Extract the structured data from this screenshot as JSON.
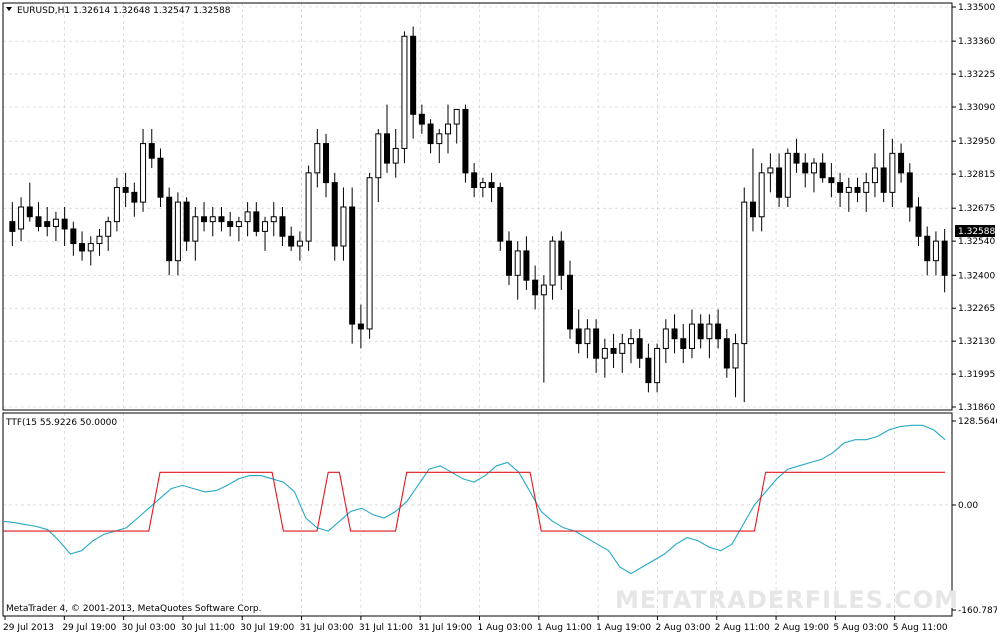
{
  "symbol_info": "EURUSD,H1  1.32614 1.32648 1.32547 1.32588",
  "indicator_info": "TTF(15 55.9226 50.0000",
  "copyright": "MetaTrader 4, © 2001-2013, MetaQuotes Software Corp.",
  "watermark": "METATRADERFILES.COM",
  "current_price": "1.32588",
  "colors": {
    "background": "#ffffff",
    "grid": "#c8c8c8",
    "bull_candle_fill": "#ffffff",
    "bear_candle_fill": "#000000",
    "ttf_line": "#26a9c7",
    "signal_line": "#e0181e",
    "price_badge": "#000000"
  },
  "chart_data": [
    {
      "type": "candlestick",
      "symbol": "EURUSD",
      "timeframe": "H1",
      "y_ticks": [
        "1.33500",
        "1.33360",
        "1.33225",
        "1.33090",
        "1.32950",
        "1.32815",
        "1.32675",
        "1.32540",
        "1.32400",
        "1.32265",
        "1.32130",
        "1.31995",
        "1.31860"
      ],
      "ylim": [
        1.3186,
        1.335
      ],
      "x_ticks": [
        "29 Jul 2013",
        "29 Jul 19:00",
        "30 Jul 03:00",
        "30 Jul 11:00",
        "30 Jul 19:00",
        "31 Jul 03:00",
        "31 Jul 11:00",
        "31 Jul 19:00",
        "1 Aug 03:00",
        "1 Aug 11:00",
        "1 Aug 19:00",
        "2 Aug 03:00",
        "2 Aug 11:00",
        "2 Aug 19:00",
        "5 Aug 03:00",
        "5 Aug 11:00"
      ],
      "ohlc": [
        [
          1.3262,
          1.327,
          1.3252,
          1.3258
        ],
        [
          1.3259,
          1.3272,
          1.3254,
          1.3268
        ],
        [
          1.3268,
          1.3278,
          1.3262,
          1.3264
        ],
        [
          1.3264,
          1.327,
          1.3258,
          1.326
        ],
        [
          1.3262,
          1.3268,
          1.3256,
          1.326
        ],
        [
          1.326,
          1.3266,
          1.3254,
          1.3263
        ],
        [
          1.3263,
          1.3268,
          1.3252,
          1.3259
        ],
        [
          1.3259,
          1.3262,
          1.3248,
          1.3253
        ],
        [
          1.3253,
          1.3258,
          1.3246,
          1.325
        ],
        [
          1.325,
          1.3256,
          1.3244,
          1.3253
        ],
        [
          1.3253,
          1.3259,
          1.3248,
          1.3256
        ],
        [
          1.3256,
          1.3264,
          1.325,
          1.3262
        ],
        [
          1.3262,
          1.328,
          1.3258,
          1.3276
        ],
        [
          1.3276,
          1.3282,
          1.3268,
          1.3274
        ],
        [
          1.3274,
          1.3278,
          1.3264,
          1.327
        ],
        [
          1.327,
          1.33,
          1.3266,
          1.3294
        ],
        [
          1.3294,
          1.33,
          1.3284,
          1.3288
        ],
        [
          1.3288,
          1.3292,
          1.3268,
          1.3272
        ],
        [
          1.3272,
          1.3276,
          1.324,
          1.3246
        ],
        [
          1.3246,
          1.3274,
          1.324,
          1.327
        ],
        [
          1.327,
          1.3272,
          1.325,
          1.3254
        ],
        [
          1.3254,
          1.3268,
          1.3246,
          1.3264
        ],
        [
          1.3264,
          1.327,
          1.3258,
          1.3262
        ],
        [
          1.3262,
          1.3268,
          1.3256,
          1.3264
        ],
        [
          1.3264,
          1.3268,
          1.3258,
          1.3262
        ],
        [
          1.3262,
          1.3266,
          1.3256,
          1.326
        ],
        [
          1.326,
          1.3264,
          1.3254,
          1.3262
        ],
        [
          1.3262,
          1.327,
          1.3256,
          1.3266
        ],
        [
          1.3266,
          1.327,
          1.3256,
          1.3258
        ],
        [
          1.3258,
          1.3264,
          1.325,
          1.3262
        ],
        [
          1.3262,
          1.327,
          1.3256,
          1.3264
        ],
        [
          1.3264,
          1.3268,
          1.3252,
          1.3256
        ],
        [
          1.3256,
          1.326,
          1.325,
          1.3252
        ],
        [
          1.3252,
          1.3258,
          1.3246,
          1.3254
        ],
        [
          1.3254,
          1.3285,
          1.325,
          1.3282
        ],
        [
          1.3282,
          1.33,
          1.3276,
          1.3294
        ],
        [
          1.3294,
          1.3298,
          1.3272,
          1.3278
        ],
        [
          1.3278,
          1.3282,
          1.3246,
          1.3252
        ],
        [
          1.3252,
          1.3276,
          1.3246,
          1.3268
        ],
        [
          1.3268,
          1.3276,
          1.3212,
          1.322
        ],
        [
          1.322,
          1.3228,
          1.321,
          1.3218
        ],
        [
          1.3218,
          1.3282,
          1.3214,
          1.328
        ],
        [
          1.328,
          1.33,
          1.327,
          1.3298
        ],
        [
          1.3298,
          1.331,
          1.3282,
          1.3286
        ],
        [
          1.3286,
          1.33,
          1.328,
          1.3292
        ],
        [
          1.3292,
          1.334,
          1.3286,
          1.3338
        ],
        [
          1.3338,
          1.3342,
          1.3296,
          1.3306
        ],
        [
          1.3306,
          1.331,
          1.3298,
          1.3302
        ],
        [
          1.3302,
          1.3304,
          1.329,
          1.3294
        ],
        [
          1.3294,
          1.33,
          1.3286,
          1.3298
        ],
        [
          1.3298,
          1.331,
          1.329,
          1.3302
        ],
        [
          1.3302,
          1.3306,
          1.3294,
          1.3308
        ],
        [
          1.3308,
          1.331,
          1.3278,
          1.3282
        ],
        [
          1.3282,
          1.3286,
          1.3272,
          1.3276
        ],
        [
          1.3276,
          1.328,
          1.3272,
          1.3278
        ],
        [
          1.3278,
          1.3282,
          1.327,
          1.3276
        ],
        [
          1.3276,
          1.3278,
          1.325,
          1.3254
        ],
        [
          1.3254,
          1.3258,
          1.3236,
          1.324
        ],
        [
          1.324,
          1.3254,
          1.323,
          1.325
        ],
        [
          1.325,
          1.3256,
          1.3234,
          1.3238
        ],
        [
          1.3238,
          1.3244,
          1.3226,
          1.3232
        ],
        [
          1.3232,
          1.324,
          1.3196,
          1.3236
        ],
        [
          1.3236,
          1.3256,
          1.323,
          1.3254
        ],
        [
          1.3254,
          1.3258,
          1.3234,
          1.324
        ],
        [
          1.324,
          1.3246,
          1.3214,
          1.3218
        ],
        [
          1.3218,
          1.3226,
          1.3208,
          1.3212
        ],
        [
          1.3212,
          1.3222,
          1.3206,
          1.3218
        ],
        [
          1.3218,
          1.3222,
          1.32,
          1.3206
        ],
        [
          1.3206,
          1.3214,
          1.3198,
          1.321
        ],
        [
          1.321,
          1.3216,
          1.3202,
          1.3208
        ],
        [
          1.3208,
          1.3216,
          1.32,
          1.3212
        ],
        [
          1.3212,
          1.3218,
          1.3204,
          1.3214
        ],
        [
          1.3214,
          1.3218,
          1.3202,
          1.3206
        ],
        [
          1.3206,
          1.3212,
          1.3192,
          1.3196
        ],
        [
          1.3196,
          1.3212,
          1.3192,
          1.321
        ],
        [
          1.321,
          1.3222,
          1.3204,
          1.3218
        ],
        [
          1.3218,
          1.3224,
          1.3208,
          1.3214
        ],
        [
          1.3214,
          1.322,
          1.3204,
          1.321
        ],
        [
          1.321,
          1.3226,
          1.3206,
          1.322
        ],
        [
          1.322,
          1.3224,
          1.321,
          1.3214
        ],
        [
          1.3214,
          1.3224,
          1.3206,
          1.322
        ],
        [
          1.322,
          1.3226,
          1.321,
          1.3214
        ],
        [
          1.3214,
          1.3218,
          1.3198,
          1.3202
        ],
        [
          1.3202,
          1.3216,
          1.319,
          1.3212
        ],
        [
          1.3212,
          1.3276,
          1.3188,
          1.327
        ],
        [
          1.327,
          1.3292,
          1.3258,
          1.3264
        ],
        [
          1.3264,
          1.3286,
          1.3258,
          1.3282
        ],
        [
          1.3282,
          1.329,
          1.3274,
          1.3284
        ],
        [
          1.3284,
          1.329,
          1.3268,
          1.3272
        ],
        [
          1.3272,
          1.3292,
          1.3268,
          1.329
        ],
        [
          1.329,
          1.3296,
          1.3282,
          1.3286
        ],
        [
          1.3286,
          1.329,
          1.3276,
          1.3282
        ],
        [
          1.3282,
          1.3288,
          1.3274,
          1.3286
        ],
        [
          1.3286,
          1.329,
          1.3278,
          1.328
        ],
        [
          1.328,
          1.3286,
          1.3272,
          1.3278
        ],
        [
          1.3278,
          1.3282,
          1.3268,
          1.3274
        ],
        [
          1.3274,
          1.328,
          1.3266,
          1.3276
        ],
        [
          1.3276,
          1.328,
          1.327,
          1.3274
        ],
        [
          1.3274,
          1.3282,
          1.3266,
          1.3278
        ],
        [
          1.3278,
          1.329,
          1.3272,
          1.3284
        ],
        [
          1.3284,
          1.33,
          1.327,
          1.3274
        ],
        [
          1.3274,
          1.3296,
          1.3268,
          1.329
        ],
        [
          1.329,
          1.3294,
          1.3278,
          1.3282
        ],
        [
          1.3282,
          1.3286,
          1.3262,
          1.3268
        ],
        [
          1.3268,
          1.3272,
          1.3252,
          1.3256
        ],
        [
          1.3256,
          1.326,
          1.324,
          1.3246
        ],
        [
          1.3246,
          1.3258,
          1.324,
          1.3254
        ],
        [
          1.3254,
          1.3259,
          1.3233,
          1.324
        ]
      ]
    },
    {
      "type": "line",
      "name": "TTF",
      "y_ticks": [
        "128.5646",
        "0.00",
        "-160.7873"
      ],
      "ylim": [
        -160.7873,
        128.5646
      ],
      "series": [
        {
          "name": "TTF",
          "values": [
            -25,
            -27,
            -30,
            -33,
            -38,
            -55,
            -75,
            -70,
            -55,
            -45,
            -40,
            -35,
            -20,
            -5,
            10,
            25,
            30,
            25,
            20,
            22,
            30,
            40,
            45,
            45,
            40,
            35,
            20,
            -20,
            -35,
            -40,
            -25,
            -10,
            -5,
            -15,
            -20,
            -10,
            5,
            30,
            55,
            60,
            50,
            40,
            35,
            45,
            60,
            65,
            50,
            20,
            -10,
            -25,
            -35,
            -40,
            -50,
            -60,
            -70,
            -95,
            -105,
            -95,
            -85,
            -75,
            -60,
            -50,
            -55,
            -65,
            -70,
            -60,
            -30,
            0,
            20,
            40,
            55,
            60,
            65,
            70,
            80,
            95,
            100,
            100,
            105,
            115,
            120,
            122,
            122,
            115,
            100
          ]
        },
        {
          "name": "Signal",
          "values": [
            -40,
            -40,
            -40,
            -40,
            -40,
            -40,
            -40,
            -40,
            -40,
            -40,
            -40,
            -40,
            -40,
            -40,
            50,
            50,
            50,
            50,
            50,
            50,
            50,
            50,
            50,
            50,
            50,
            -40,
            -40,
            -40,
            -40,
            50,
            50,
            -40,
            -40,
            -40,
            -40,
            -40,
            50,
            50,
            50,
            50,
            50,
            50,
            50,
            50,
            50,
            50,
            50,
            50,
            -40,
            -40,
            -40,
            -40,
            -40,
            -40,
            -40,
            -40,
            -40,
            -40,
            -40,
            -40,
            -40,
            -40,
            -40,
            -40,
            -40,
            -40,
            -40,
            -40,
            50,
            50,
            50,
            50,
            50,
            50,
            50,
            50,
            50,
            50,
            50,
            50,
            50,
            50,
            50,
            50,
            50
          ]
        }
      ]
    }
  ]
}
